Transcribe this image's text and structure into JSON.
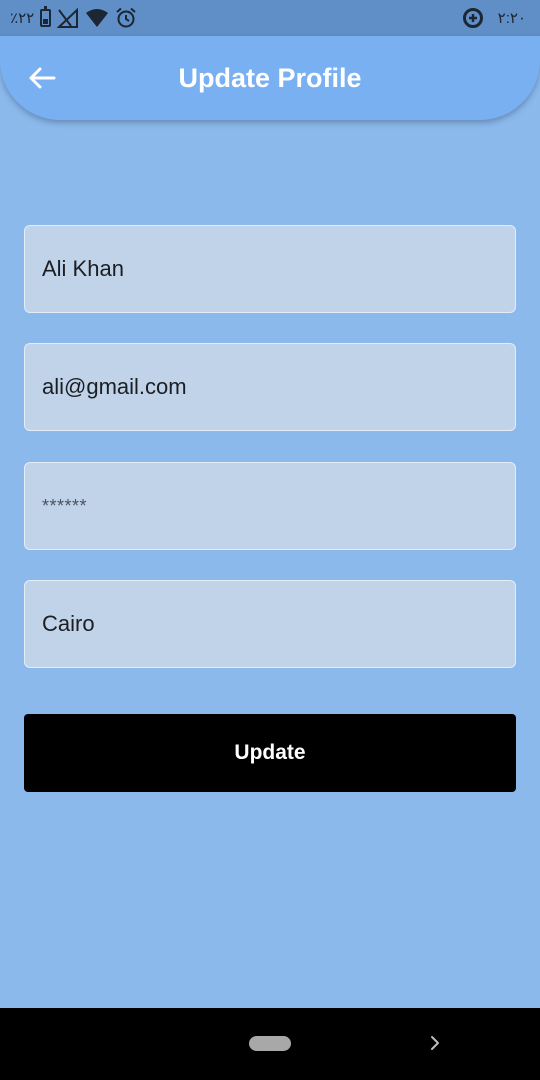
{
  "status_bar": {
    "battery_text": "٪٢٢",
    "time": "٢:٢٠",
    "icons": [
      "battery-icon",
      "signal-off-icon",
      "wifi-icon",
      "alarm-icon",
      "data-saver-icon"
    ]
  },
  "app_bar": {
    "title": "Update Profile",
    "back_icon": "arrow-left-icon",
    "background": "#78b0f2"
  },
  "form": {
    "name": {
      "value": "Ali Khan"
    },
    "email": {
      "value": "ali@gmail.com"
    },
    "password": {
      "value": "******"
    },
    "city": {
      "value": "Cairo"
    }
  },
  "update_button": {
    "label": "Update"
  },
  "colors": {
    "page_background": "#8bb9ec",
    "field_background": "#c1d3e8",
    "button_background": "#000000"
  },
  "nav_bar": {
    "icons": [
      "home-pill-icon",
      "chevron-right-icon"
    ]
  }
}
